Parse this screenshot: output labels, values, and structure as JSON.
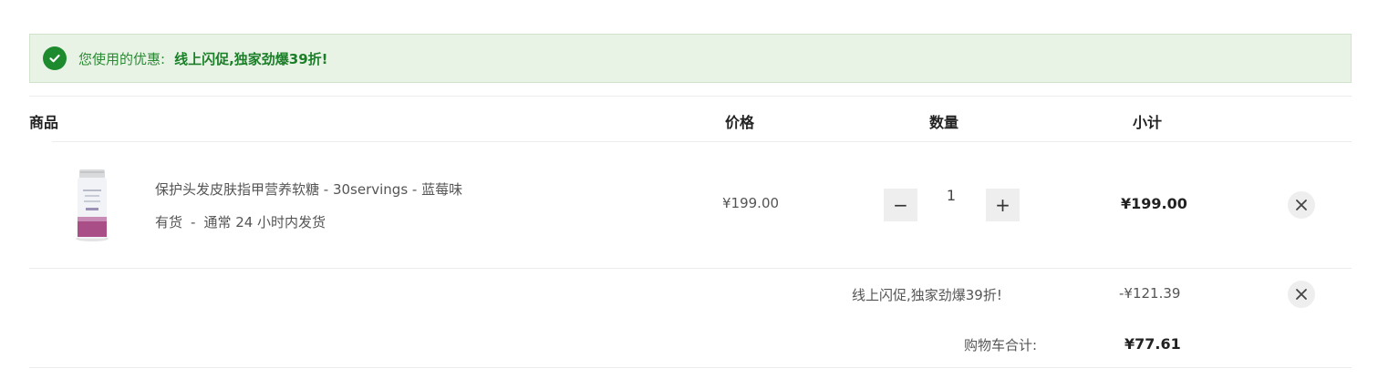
{
  "banner": {
    "label": "您使用的优惠:",
    "promo": "线上闪促,独家劲爆39折!",
    "icon": "check-circle-icon",
    "color": "#1e8a2e"
  },
  "table": {
    "headers": {
      "product": "商品",
      "price": "价格",
      "quantity": "数量",
      "subtotal": "小计"
    }
  },
  "item": {
    "name": "保护头发皮肤指甲营养软糖 - 30servings - 蓝莓味",
    "stock": "有货",
    "stock_sep": "-",
    "shipping": "通常 24 小时内发货",
    "price": "¥199.00",
    "quantity": "1",
    "decrease_symbol": "−",
    "increase_symbol": "+",
    "subtotal": "¥199.00"
  },
  "discount": {
    "label": "线上闪促,独家劲爆39折!",
    "amount": "-¥121.39"
  },
  "total": {
    "label": "购物车合计:",
    "amount": "¥77.61"
  }
}
